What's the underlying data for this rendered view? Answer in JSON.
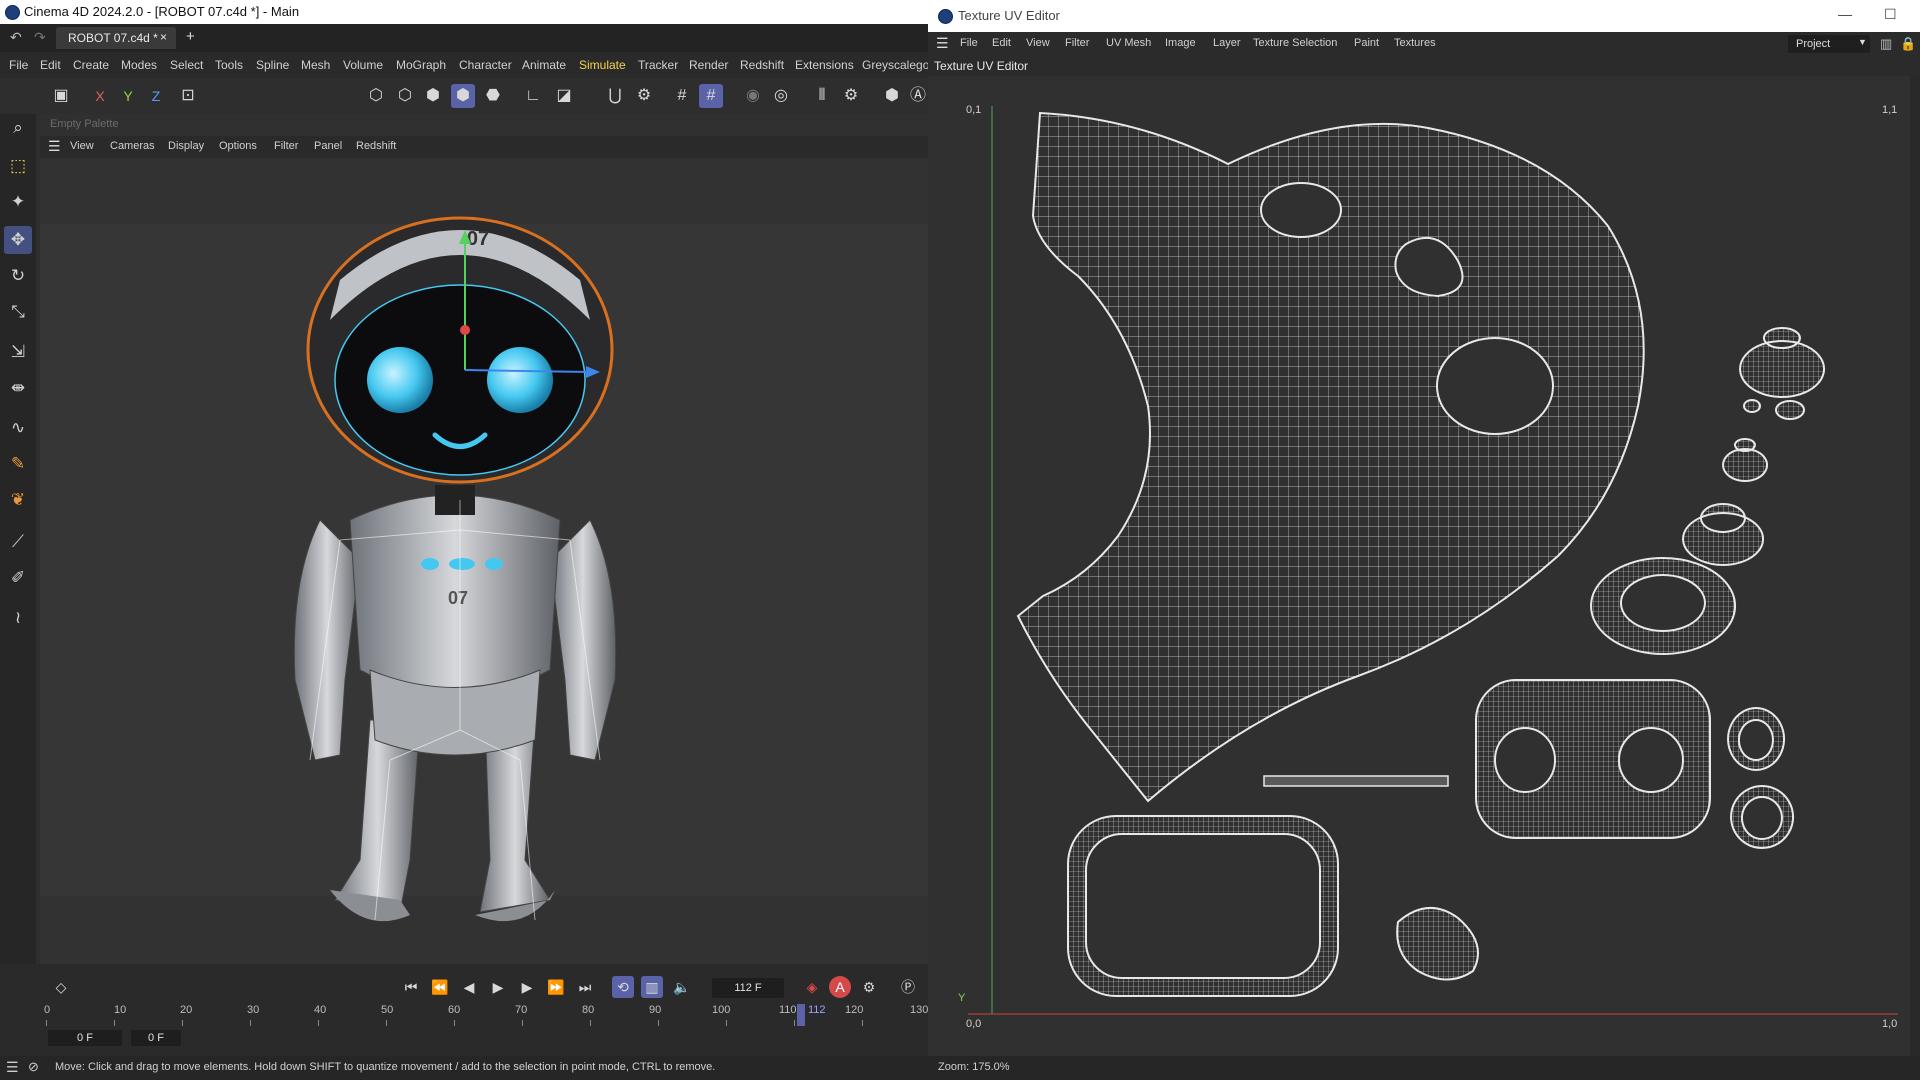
{
  "main_window": {
    "title": "Cinema 4D 2024.2.0 - [ROBOT 07.c4d *] - Main",
    "tab": {
      "label": "ROBOT 07.c4d *",
      "close": "×",
      "add": "+"
    },
    "menu": [
      "File",
      "Edit",
      "Create",
      "Modes",
      "Select",
      "Tools",
      "Spline",
      "Mesh",
      "Volume",
      "MoGraph",
      "Character",
      "Animate",
      "Simulate",
      "Tracker",
      "Render",
      "Redshift",
      "Extensions",
      "Greyscalegor"
    ],
    "active_menu": "Simulate",
    "axis_toggles": [
      "X",
      "Y",
      "Z"
    ],
    "palette_label": "Empty Palette",
    "viewport_menu": [
      "View",
      "Cameras",
      "Display",
      "Options",
      "Filter",
      "Panel",
      "Redshift"
    ],
    "robot": {
      "helmet_label": "07",
      "chest_label": "07"
    },
    "timeline": {
      "current_frame": "112 F",
      "ruler_ticks": [
        "0",
        "10",
        "20",
        "30",
        "40",
        "50",
        "60",
        "70",
        "80",
        "90",
        "100",
        "110",
        "120",
        "130"
      ],
      "playhead_label": "112",
      "start_field": "0 F",
      "end_field": "0 F"
    },
    "status_text": "Move: Click and drag to move elements. Hold down SHIFT to quantize movement / add to the selection in point mode, CTRL to remove."
  },
  "uv_window": {
    "title": "Texture UV Editor",
    "menu": [
      "File",
      "Edit",
      "View",
      "Filter",
      "UV Mesh",
      "Image",
      "Layer",
      "Texture Selection",
      "Paint",
      "Textures"
    ],
    "project_select": "Project",
    "panel_title": "Texture UV Editor",
    "corner_labels": {
      "top_left": "0,1",
      "top_right": "1,1",
      "bottom_left": "0,0",
      "bottom_right": "1,0",
      "axis_y": "Y"
    },
    "zoom_text": "Zoom: 175.0%"
  },
  "colors": {
    "accent": "#5a63a8",
    "active_menu": "#f5d253",
    "robot_eye": "#45c8f0",
    "helmet_outline": "#d9701f"
  }
}
